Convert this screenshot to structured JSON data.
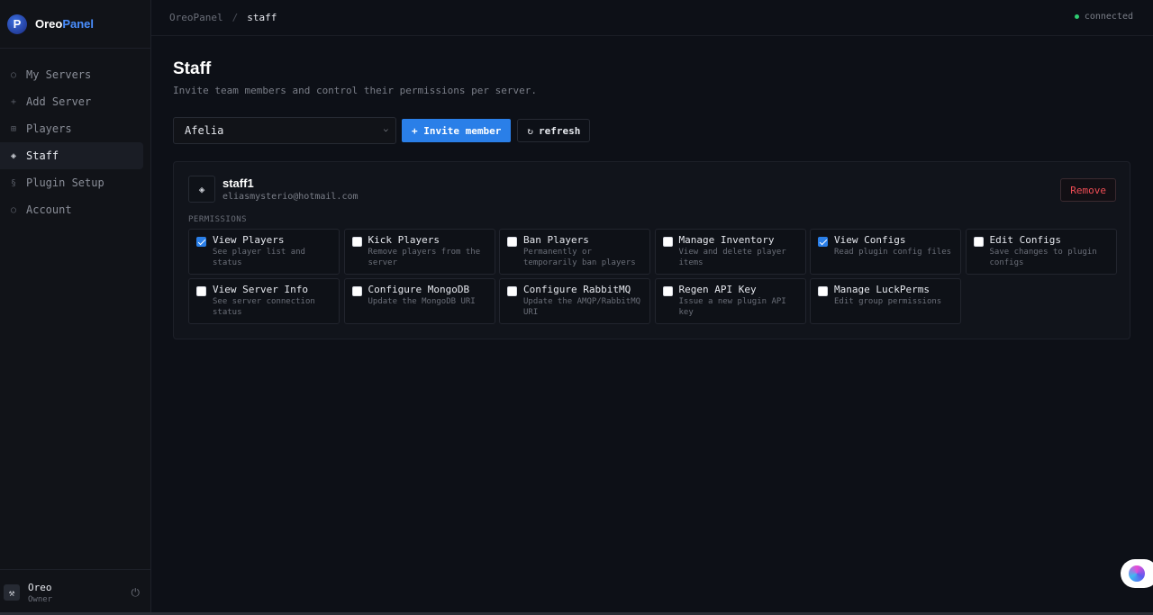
{
  "brand": {
    "logo_text": "P",
    "name_part1": "Oreo",
    "name_part2": "Panel"
  },
  "nav": {
    "items": [
      {
        "label": "My Servers",
        "icon": "○"
      },
      {
        "label": "Add Server",
        "icon": "+"
      },
      {
        "label": "Players",
        "icon": "⊞"
      },
      {
        "label": "Staff",
        "icon": "◈"
      },
      {
        "label": "Plugin Setup",
        "icon": "§"
      },
      {
        "label": "Account",
        "icon": "○"
      }
    ]
  },
  "user": {
    "name": "Oreo",
    "role": "Owner",
    "avatar_icon": "⚒",
    "power_icon": "⏻"
  },
  "topbar": {
    "crumb_root": "OreoPanel",
    "crumb_sep": "/",
    "crumb_current": "staff",
    "status": "connected",
    "status_color": "#2ecc71"
  },
  "page": {
    "title": "Staff",
    "subtitle": "Invite team members and control their permissions per server."
  },
  "controls": {
    "server_select": "Afelia",
    "chevron": "⌵",
    "invite_label": "+ Invite member",
    "refresh_icon": "↻",
    "refresh_label": "refresh"
  },
  "member": {
    "icon": "◈",
    "name": "staff1",
    "email": "eliasmysterio@hotmail.com",
    "remove_label": "Remove",
    "permissions_label": "PERMISSIONS",
    "permissions": [
      {
        "title": "View Players",
        "desc": "See player list and status",
        "checked": true
      },
      {
        "title": "Kick Players",
        "desc": "Remove players from the server",
        "checked": false
      },
      {
        "title": "Ban Players",
        "desc": "Permanently or temporarily ban players",
        "checked": false
      },
      {
        "title": "Manage Inventory",
        "desc": "View and delete player items",
        "checked": false
      },
      {
        "title": "View Configs",
        "desc": "Read plugin config files",
        "checked": true
      },
      {
        "title": "Edit Configs",
        "desc": "Save changes to plugin configs",
        "checked": false
      },
      {
        "title": "View Server Info",
        "desc": "See server connection status",
        "checked": false
      },
      {
        "title": "Configure MongoDB",
        "desc": "Update the MongoDB URI",
        "checked": false
      },
      {
        "title": "Configure RabbitMQ",
        "desc": "Update the AMQP/RabbitMQ URI",
        "checked": false
      },
      {
        "title": "Regen API Key",
        "desc": "Issue a new plugin API key",
        "checked": false
      },
      {
        "title": "Manage LuckPerms",
        "desc": "Edit group permissions",
        "checked": false
      }
    ]
  },
  "colors": {
    "accent": "#2a7fe8",
    "danger": "#ef4d55",
    "background": "#0d1017"
  }
}
